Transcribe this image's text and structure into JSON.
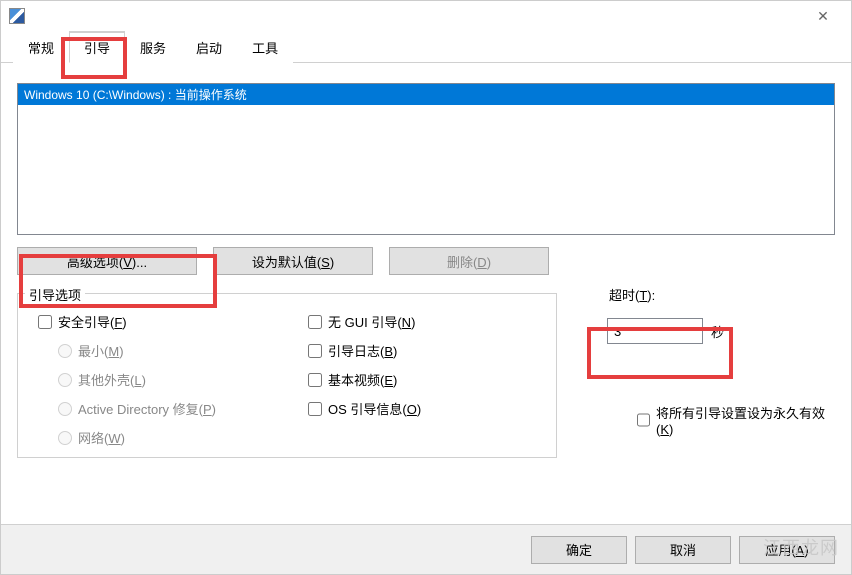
{
  "titlebar": {
    "close": "✕"
  },
  "tabs": {
    "general": "常规",
    "boot": "引导",
    "services": "服务",
    "startup": "启动",
    "tools": "工具"
  },
  "list": {
    "item0": "Windows 10 (C:\\Windows) : 当前操作系统"
  },
  "buttons": {
    "advanced_pre": "高级选项(",
    "advanced_u": "V",
    "advanced_post": ")...",
    "setdefault_pre": "设为默认值(",
    "setdefault_u": "S",
    "setdefault_post": ")",
    "delete_pre": "删除(",
    "delete_u": "D",
    "delete_post": ")"
  },
  "bootopts": {
    "legend": "引导选项",
    "safeboot_pre": "安全引导(",
    "safeboot_u": "F",
    "safeboot_post": ")",
    "minimal_pre": "最小(",
    "minimal_u": "M",
    "minimal_post": ")",
    "altshell_pre": "其他外壳(",
    "altshell_u": "L",
    "altshell_post": ")",
    "ad_pre": "Active Directory 修复(",
    "ad_u": "P",
    "ad_post": ")",
    "network_pre": "网络(",
    "network_u": "W",
    "network_post": ")",
    "nogui_pre": "无 GUI 引导(",
    "nogui_u": "N",
    "nogui_post": ")",
    "bootlog_pre": "引导日志(",
    "bootlog_u": "B",
    "bootlog_post": ")",
    "basevideo_pre": "基本视频(",
    "basevideo_u": "E",
    "basevideo_post": ")",
    "osinfo_pre": "OS 引导信息(",
    "osinfo_u": "O",
    "osinfo_post": ")"
  },
  "timeout": {
    "label_pre": "超时(",
    "label_u": "T",
    "label_post": "):",
    "value": "3",
    "seconds": "秒"
  },
  "permanent": {
    "line1_pre": "将所有引导设置设为永久有效",
    "line2_pre": "(",
    "line2_u": "K",
    "line2_post": ")"
  },
  "bottom": {
    "ok": "确定",
    "cancel": "取消",
    "apply_pre": "应用(",
    "apply_u": "A",
    "apply_post": ")"
  },
  "watermark": "江西龙网"
}
